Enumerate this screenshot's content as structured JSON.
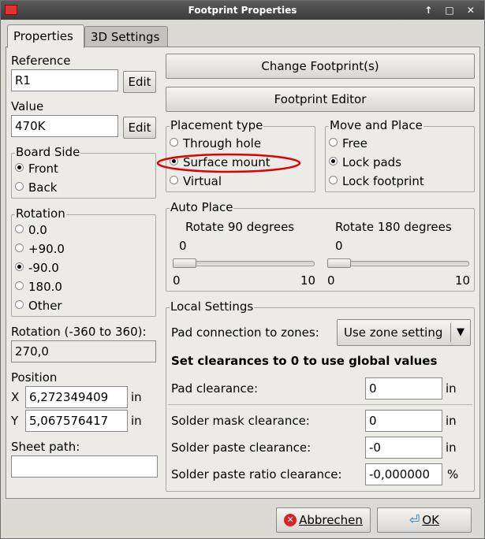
{
  "window": {
    "title": "Footprint Properties",
    "controls": "↑ □ ✕"
  },
  "tabs": [
    {
      "label": "Properties"
    },
    {
      "label": "3D Settings"
    }
  ],
  "reference": {
    "label": "Reference",
    "value": "R1",
    "edit_label": "Edit"
  },
  "value": {
    "label": "Value",
    "value": "470K",
    "edit_label": "Edit"
  },
  "board_side": {
    "title": "Board Side",
    "options": [
      "Front",
      "Back"
    ],
    "selected": "Front"
  },
  "rotation": {
    "title": "Rotation",
    "options": [
      "0.0",
      "+90.0",
      "-90.0",
      "180.0",
      "Other"
    ],
    "selected": "-90.0",
    "custom_label": "Rotation (-360 to 360):",
    "custom_value": "270,0"
  },
  "position": {
    "label": "Position",
    "x_label": "X",
    "x_value": "6,272349409",
    "y_label": "Y",
    "y_value": "5,067576417",
    "unit": "in"
  },
  "sheet_path": {
    "label": "Sheet path:",
    "value": ""
  },
  "actions": {
    "change_footprint": "Change Footprint(s)",
    "footprint_editor": "Footprint Editor"
  },
  "placement_type": {
    "title": "Placement type",
    "options": [
      "Through hole",
      "Surface mount",
      "Virtual"
    ],
    "selected": "Surface mount",
    "highlight_color": "#e00000"
  },
  "move_place": {
    "title": "Move and Place",
    "options": [
      "Free",
      "Lock pads",
      "Lock footprint"
    ],
    "selected": "Lock pads"
  },
  "auto_place": {
    "title": "Auto Place",
    "rot90": {
      "label": "Rotate 90 degrees",
      "value": "0",
      "min": "0",
      "max": "10",
      "level": 0
    },
    "rot180": {
      "label": "Rotate 180 degrees",
      "value": "0",
      "min": "0",
      "max": "10",
      "level": 0
    }
  },
  "local_settings": {
    "title": "Local Settings",
    "pad_connection_label": "Pad connection to zones:",
    "pad_connection_value": "Use zone setting",
    "note": "Set clearances to 0 to use global values",
    "rows": [
      {
        "label": "Pad clearance:",
        "value": "0",
        "unit": "in"
      },
      {
        "label": "Solder mask clearance:",
        "value": "0",
        "unit": "in"
      },
      {
        "label": "Solder paste clearance:",
        "value": "-0",
        "unit": "in"
      },
      {
        "label": "Solder paste ratio clearance:",
        "value": "-0,000000",
        "unit": "%"
      }
    ]
  },
  "buttons": {
    "cancel": "Abbrechen",
    "ok": "OK"
  }
}
